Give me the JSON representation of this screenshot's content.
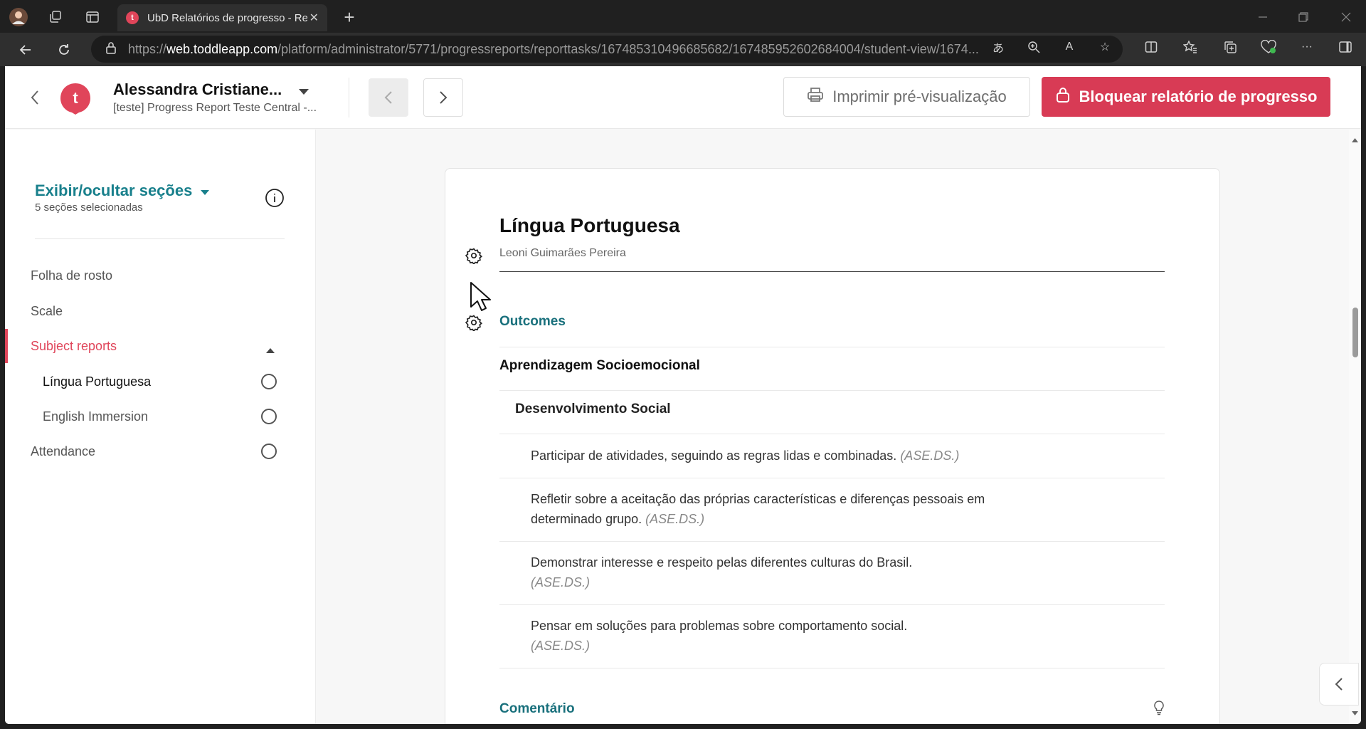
{
  "browser": {
    "tab_title": "UbD Relatórios de progresso - Re",
    "tab_favicon_letter": "t",
    "url_prefix": "https://",
    "url_host": "web.toddleapp.com",
    "url_path": "/platform/administrator/5771/progressreports/reporttasks/167485310496685682/167485952602684004/student-view/1674..."
  },
  "header": {
    "logo_letter": "t",
    "student_name": "Alessandra Cristiane...",
    "report_name": "[teste] Progress Report Teste Central -...",
    "print_label": "Imprimir pré-visualização",
    "lock_label": "Bloquear relatório de progresso"
  },
  "sidebar": {
    "toggle_label": "Exibir/ocultar seções",
    "sections_count": "5 seções selecionadas",
    "items": [
      {
        "label": "Folha de rosto"
      },
      {
        "label": "Scale"
      },
      {
        "label": "Subject reports"
      },
      {
        "label": "Língua Portuguesa"
      },
      {
        "label": "English Immersion"
      },
      {
        "label": "Attendance"
      }
    ]
  },
  "report": {
    "subject": "Língua Portuguesa",
    "teacher": "Leoni Guimarães Pereira",
    "outcomes_heading": "Outcomes",
    "group": "Aprendizagem Socioemocional",
    "subgroup": "Desenvolvimento Social",
    "outcomes": [
      {
        "text": "Participar de atividades, seguindo as regras lidas e combinadas.",
        "code": "(ASE.DS.)"
      },
      {
        "text": "Refletir sobre a aceitação das próprias características e diferenças pessoais em determinado grupo.",
        "code": "(ASE.DS.)"
      },
      {
        "text": "Demonstrar interesse e respeito pelas diferentes culturas do Brasil.",
        "code": "(ASE.DS.)"
      },
      {
        "text": "Pensar em soluções para problemas sobre comportamento social.",
        "code": "(ASE.DS.)"
      }
    ],
    "comment_heading": "Comentário"
  },
  "colors": {
    "brand": "#e0455a",
    "lock_button": "#d83b55",
    "teal": "#19707c"
  }
}
